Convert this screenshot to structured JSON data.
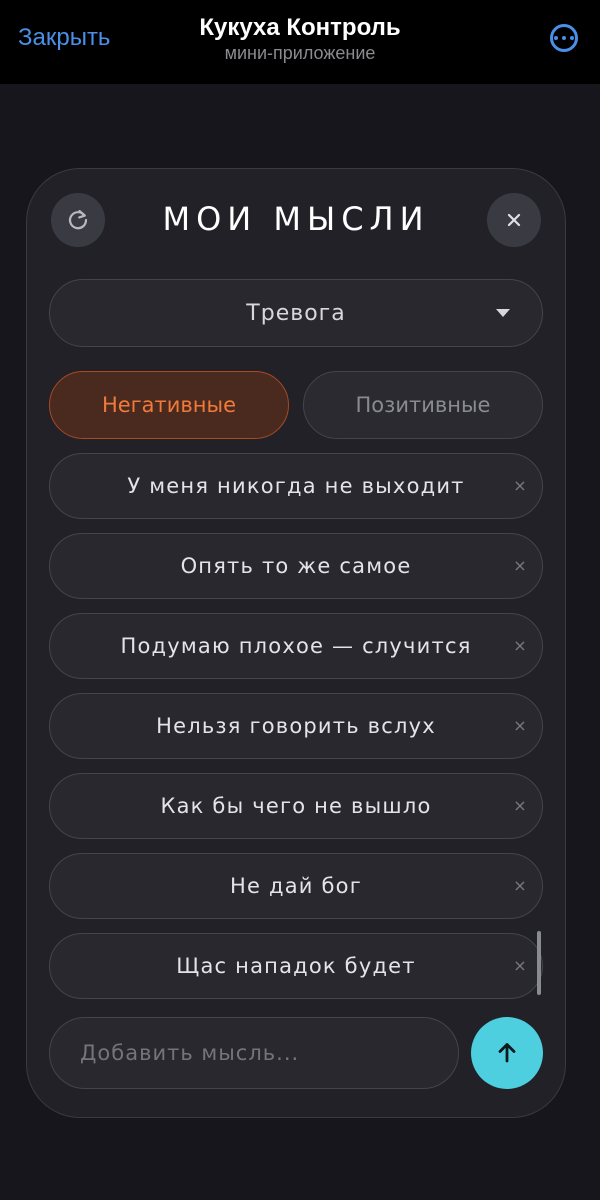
{
  "header": {
    "close_label": "Закрыть",
    "title": "Кукуха Контроль",
    "subtitle": "мини-приложение",
    "more_icon": "ellipsis-circle-icon",
    "accent_color": "#4a8fe8"
  },
  "card": {
    "title": "МОИ МЫСЛИ",
    "refresh_icon": "refresh-icon",
    "close_icon": "close-icon"
  },
  "category": {
    "selected": "Тревога",
    "caret_icon": "caret-down-icon"
  },
  "filters": {
    "negative_label": "Негативные",
    "positive_label": "Позитивные",
    "active": "negative",
    "active_color": "#f07a3a"
  },
  "thoughts": [
    {
      "text": "У меня никогда не выходит",
      "delete_glyph": "×"
    },
    {
      "text": "Опять то же самое",
      "delete_glyph": "×"
    },
    {
      "text": "Подумаю плохое — случится",
      "delete_glyph": "×"
    },
    {
      "text": "Нельзя говорить вслух",
      "delete_glyph": "×"
    },
    {
      "text": "Как бы чего не вышло",
      "delete_glyph": "×"
    },
    {
      "text": "Не дай бог",
      "delete_glyph": "×"
    },
    {
      "text": "Щас нападок будет",
      "delete_glyph": "×"
    }
  ],
  "composer": {
    "placeholder": "Добавить мысль...",
    "value": "",
    "send_icon": "arrow-up-icon",
    "send_color": "#4dcfe0"
  }
}
